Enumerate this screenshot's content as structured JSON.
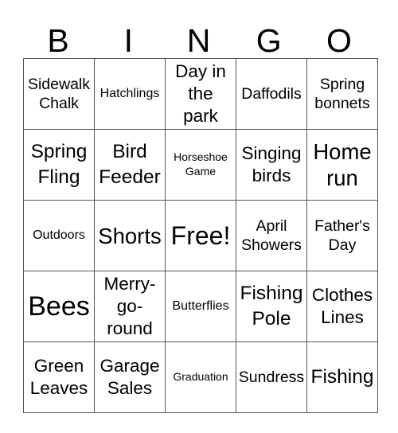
{
  "header": {
    "letters": [
      "B",
      "I",
      "N",
      "G",
      "O"
    ]
  },
  "grid": {
    "rows": [
      [
        {
          "text": "Sidewalk Chalk",
          "lines": [
            "Sidewalk",
            "Chalk"
          ],
          "size": "md"
        },
        {
          "text": "Hatchlings",
          "lines": [
            "Hatchlings"
          ],
          "size": "sm"
        },
        {
          "text": "Day in the park",
          "lines": [
            "Day in",
            "the",
            "park"
          ],
          "size": "lg"
        },
        {
          "text": "Daffodils",
          "lines": [
            "Daffodils"
          ],
          "size": "md"
        },
        {
          "text": "Spring bonnets",
          "lines": [
            "Spring",
            "bonnets"
          ],
          "size": "md"
        }
      ],
      [
        {
          "text": "Spring Fling",
          "lines": [
            "Spring",
            "Fling"
          ],
          "size": "xl"
        },
        {
          "text": "Bird Feeder",
          "lines": [
            "Bird",
            "Feeder"
          ],
          "size": "xl"
        },
        {
          "text": "Horseshoe Game",
          "lines": [
            "Horseshoe",
            "Game"
          ],
          "size": "xs"
        },
        {
          "text": "Singing birds",
          "lines": [
            "Singing",
            "birds"
          ],
          "size": "lg"
        },
        {
          "text": "Home run",
          "lines": [
            "Home",
            "run"
          ],
          "size": "xxl"
        }
      ],
      [
        {
          "text": "Outdoors",
          "lines": [
            "Outdoors"
          ],
          "size": "sm"
        },
        {
          "text": "Shorts",
          "lines": [
            "Shorts"
          ],
          "size": "xxl"
        },
        {
          "text": "Free!",
          "lines": [
            "Free!"
          ],
          "size": "free"
        },
        {
          "text": "April Showers",
          "lines": [
            "April",
            "Showers"
          ],
          "size": "md"
        },
        {
          "text": "Father's Day",
          "lines": [
            "Father's",
            "Day"
          ],
          "size": "md"
        }
      ],
      [
        {
          "text": "Bees",
          "lines": [
            "Bees"
          ],
          "size": "huge"
        },
        {
          "text": "Merry-go-round",
          "lines": [
            "Merry-",
            "go-",
            "round"
          ],
          "size": "lg"
        },
        {
          "text": "Butterflies",
          "lines": [
            "Butterflies"
          ],
          "size": "sm"
        },
        {
          "text": "Fishing Pole",
          "lines": [
            "Fishing",
            "Pole"
          ],
          "size": "xl"
        },
        {
          "text": "Clothes Lines",
          "lines": [
            "Clothes",
            "Lines"
          ],
          "size": "lg"
        }
      ],
      [
        {
          "text": "Green Leaves",
          "lines": [
            "Green",
            "Leaves"
          ],
          "size": "lg"
        },
        {
          "text": "Garage Sales",
          "lines": [
            "Garage",
            "Sales"
          ],
          "size": "lg"
        },
        {
          "text": "Graduation",
          "lines": [
            "Graduation"
          ],
          "size": "xs"
        },
        {
          "text": "Sundress",
          "lines": [
            "Sundress"
          ],
          "size": "md"
        },
        {
          "text": "Fishing",
          "lines": [
            "Fishing"
          ],
          "size": "xl"
        }
      ]
    ]
  }
}
